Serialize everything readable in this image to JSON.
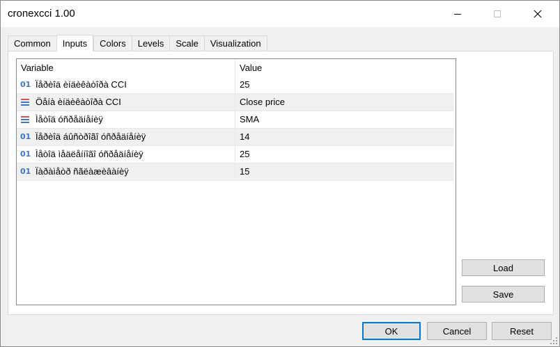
{
  "window": {
    "title": "cronexcci 1.00"
  },
  "tabs": [
    {
      "label": "Common"
    },
    {
      "label": "Inputs"
    },
    {
      "label": "Colors"
    },
    {
      "label": "Levels"
    },
    {
      "label": "Scale"
    },
    {
      "label": "Visualization"
    }
  ],
  "active_tab": "Inputs",
  "grid": {
    "columns": {
      "variable": "Variable",
      "value": "Value"
    },
    "rows": [
      {
        "icon": "integer-icon",
        "icon_text": "01",
        "variable": "Ïåðèîä èíäèêàòîðà CCI",
        "value": "25"
      },
      {
        "icon": "enum-icon",
        "icon_text": "",
        "variable": "Öåíà èíäèêàòîðà CCI",
        "value": "Close price"
      },
      {
        "icon": "enum-icon",
        "icon_text": "",
        "variable": "Ìåòîä óñðåäíåíèÿ",
        "value": "SMA"
      },
      {
        "icon": "integer-icon",
        "icon_text": "01",
        "variable": "Ïåðèîä áûñòðîãî óñðåäíåíèÿ",
        "value": "14"
      },
      {
        "icon": "integer-icon",
        "icon_text": "01",
        "variable": "Ìåòîä ìåäëåííîãî óñðåäíåíèÿ",
        "value": "25"
      },
      {
        "icon": "integer-icon",
        "icon_text": "01",
        "variable": "Ïàðàìåòð ñãëàæèâàíèÿ",
        "value": "15"
      }
    ]
  },
  "side_buttons": {
    "load": "Load",
    "save": "Save"
  },
  "footer": {
    "ok": "OK",
    "cancel": "Cancel",
    "reset": "Reset"
  },
  "colors": {
    "accent": "#0078d7",
    "int_icon": "#3a76c4",
    "enum_icon_top": "#d9534f",
    "enum_icon_bottom": "#3a76c4"
  }
}
